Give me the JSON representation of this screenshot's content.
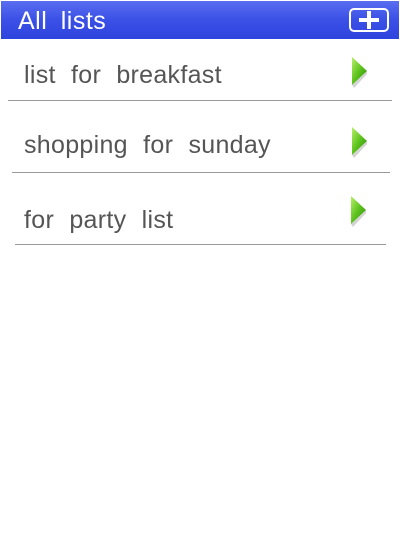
{
  "header": {
    "title": "All  lists",
    "add_icon": "plus-icon"
  },
  "lists": {
    "items": [
      {
        "label": "list  for  breakfast",
        "icon": "chevron-right-icon"
      },
      {
        "label": "shopping  for  sunday",
        "icon": "chevron-right-icon"
      },
      {
        "label": "for  party  list",
        "icon": "chevron-right-icon"
      }
    ]
  },
  "colors": {
    "header_bg": "#3a50e6",
    "header_text": "#ffffff",
    "item_text": "#555555",
    "divider": "#9a9a9a",
    "chevron": "#5cc21c"
  }
}
